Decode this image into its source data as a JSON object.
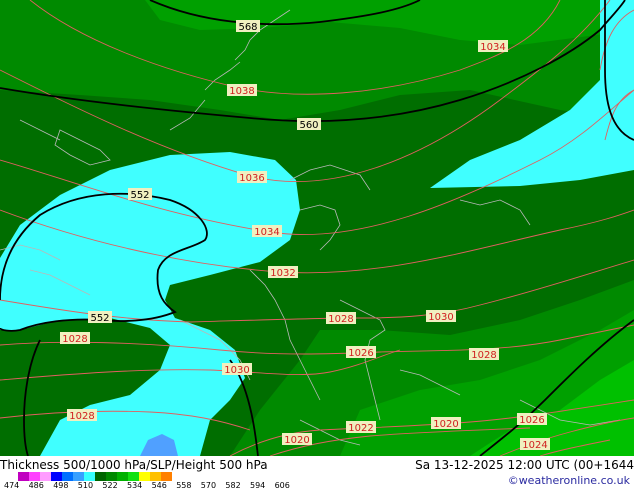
{
  "header": {
    "title": "Thickness 500/1000 hPa/SLP/Height 500 hPa",
    "valid": "Sa 13-12-2025 12:00 UTC (00+1644",
    "credit": "©weatheronline.co.uk"
  },
  "scale": {
    "ticks": [
      "474",
      "486",
      "498",
      "510",
      "522",
      "534",
      "546",
      "558",
      "570",
      "582",
      "594",
      "606"
    ],
    "colors": [
      "#c000c0",
      "#ff40ff",
      "#ff9cff",
      "#0000ff",
      "#0070ff",
      "#38a0ff",
      "#38ffff",
      "#006400",
      "#008800",
      "#00b000",
      "#10e010",
      "#ffff00",
      "#ffc000",
      "#ff8000"
    ]
  },
  "palette": {
    "dark_green": "#006e00",
    "mid_green": "#008a00",
    "light_green": "#00a000",
    "bright_green": "#00c000",
    "cyan": "#40ffff",
    "blue": "#50a0ff",
    "isobar": "#e05050",
    "height_line": "#000000",
    "coast": "#b0b0b0"
  },
  "map": {
    "height_labels": [
      "568",
      "560",
      "552",
      "552"
    ],
    "isobar_labels": [
      "1034",
      "1038",
      "1036",
      "1034",
      "1032",
      "1028",
      "1030",
      "1028",
      "1026",
      "1030",
      "1028",
      "1028",
      "1022",
      "1020",
      "1026",
      "1020",
      "1024"
    ]
  }
}
